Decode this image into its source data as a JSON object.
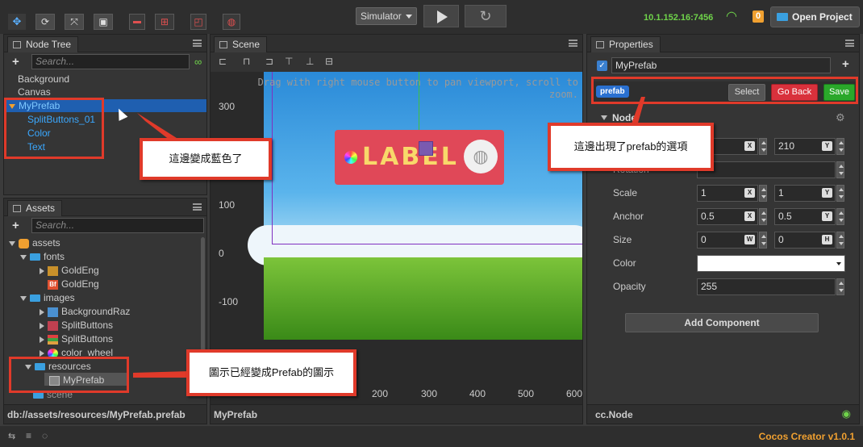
{
  "toolbar": {
    "simulator_label": "Simulator",
    "ip": "10.1.152.16:7456",
    "notification_count": "0",
    "open_project_label": "Open Project"
  },
  "node_tree": {
    "tab_label": "Node Tree",
    "search_placeholder": "Search...",
    "items": [
      {
        "label": "Background"
      },
      {
        "label": "Canvas"
      },
      {
        "label": "MyPrefab"
      },
      {
        "label": "SplitButtons_01"
      },
      {
        "label": "Color"
      },
      {
        "label": "Text"
      }
    ]
  },
  "assets": {
    "tab_label": "Assets",
    "search_placeholder": "Search...",
    "items": [
      {
        "label": "assets"
      },
      {
        "label": "fonts"
      },
      {
        "label": "GoldEng"
      },
      {
        "label": "GoldEng"
      },
      {
        "label": "images"
      },
      {
        "label": "BackgroundRaz"
      },
      {
        "label": "SplitButtons"
      },
      {
        "label": "SplitButtons"
      },
      {
        "label": "color_wheel"
      },
      {
        "label": "resources"
      },
      {
        "label": "MyPrefab"
      },
      {
        "label": "scene"
      }
    ],
    "footer_path": "db://assets/resources/MyPrefab.prefab"
  },
  "scene": {
    "tab_label": "Scene",
    "hint": "Drag with right mouse button to pan viewport, scroll to zoom.",
    "y_ticks": [
      "300",
      "100",
      "0",
      "-100"
    ],
    "x_ticks": [
      "200",
      "300",
      "400",
      "500",
      "600"
    ],
    "label_text": "LABEL",
    "footer_label": "MyPrefab"
  },
  "properties": {
    "tab_label": "Properties",
    "node_name": "MyPrefab",
    "prefab_badge": "prefab",
    "select_label": "Select",
    "go_back_label": "Go Back",
    "save_label": "Save",
    "section_label": "Node",
    "position_y": "210",
    "rotation_label": "Rotation",
    "scale_label": "Scale",
    "scale_x": "1",
    "scale_y": "1",
    "anchor_label": "Anchor",
    "anchor_x": "0.5",
    "anchor_y": "0.5",
    "size_label": "Size",
    "size_w": "0",
    "size_h": "0",
    "color_label": "Color",
    "opacity_label": "Opacity",
    "opacity_value": "255",
    "add_component_label": "Add Component",
    "footer_label": "cc.Node",
    "axis": {
      "x": "X",
      "y": "Y",
      "w": "W",
      "h": "H"
    }
  },
  "callouts": {
    "blue": "這邊變成藍色了",
    "prefab_option": "這邊出現了prefab的選項",
    "prefab_icon": "圖示已經變成Prefab的圖示"
  },
  "status_bar": {
    "version": "Cocos Creator v1.0.1"
  },
  "colors": {
    "accent_orange": "#f0a030",
    "selection_blue": "#1f5fb0",
    "tree_blue_text": "#3aa8ff",
    "callout_red": "#e03a2a",
    "go_back_red": "#d9313c",
    "save_green": "#2aa82a"
  }
}
